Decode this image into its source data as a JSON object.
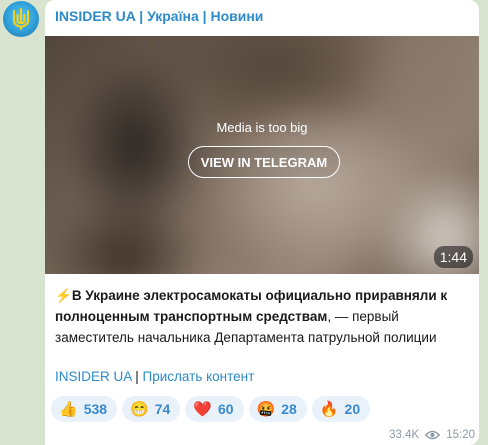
{
  "channel": {
    "name": "INSIDER UA | Україна | Новини",
    "avatar_icon": "ukraine-trident-icon"
  },
  "media": {
    "message": "Media is too big",
    "button_label": "VIEW IN TELEGRAM",
    "duration": "1:44"
  },
  "post": {
    "lightning_icon": "⚡",
    "bold_text": "В Украине электросамокаты официально приравняли к полноценным транспортным средствам",
    "normal_text": ", — первый заместитель начальника Департамента патрульной полиции",
    "link_1": "INSIDER UA",
    "separator": " | ",
    "link_2": "Прислать контент"
  },
  "reactions": [
    {
      "emoji": "👍",
      "count": "538"
    },
    {
      "emoji": "😁",
      "count": "74"
    },
    {
      "emoji": "❤️",
      "count": "60"
    },
    {
      "emoji": "🤬",
      "count": "28"
    },
    {
      "emoji": "🔥",
      "count": "20"
    }
  ],
  "meta": {
    "views": "33.4K",
    "time": "15:20"
  },
  "colors": {
    "accent": "#2c8bc9",
    "background": "#d9e4d0",
    "reaction_bg": "#e9f2fa"
  }
}
